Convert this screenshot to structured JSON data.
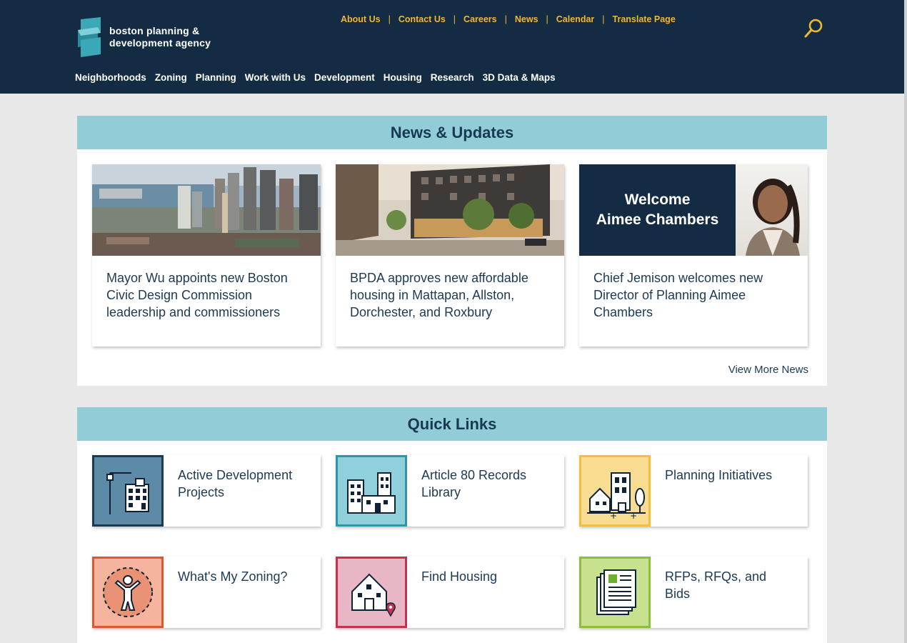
{
  "header": {
    "logo_line1": "boston planning &",
    "logo_line2": "development agency",
    "utility": [
      "About Us",
      "Contact Us",
      "Careers",
      "News",
      "Calendar",
      "Translate Page"
    ],
    "nav": [
      "Neighborhoods",
      "Zoning",
      "Planning",
      "Work with Us",
      "Development",
      "Housing",
      "Research",
      "3D Data & Maps"
    ]
  },
  "news": {
    "heading": "News & Updates",
    "cards": [
      {
        "title": "Mayor Wu appoints new Boston Civic Design Commission leadership and commissioners"
      },
      {
        "title": "BPDA approves new affordable housing in Mattapan, Allston, Dorchester, and Roxbury"
      },
      {
        "title": "Chief Jemison welcomes new Director of Planning Aimee Chambers",
        "banner_line1": "Welcome",
        "banner_line2": "Aimee Chambers"
      }
    ],
    "view_more": "View More News"
  },
  "quick_links": {
    "heading": "Quick Links",
    "items": [
      {
        "label": "Active Development Projects",
        "tile_bg": "#5d8aa6",
        "tile_border": "#1b3a52",
        "icon": "city-buildings-icon"
      },
      {
        "label": "Article 80 Records Library",
        "tile_bg": "#8fd0da",
        "tile_border": "#2a97ad",
        "icon": "buildings-library-icon"
      },
      {
        "label": "Planning Initiatives",
        "tile_bg": "#f7dc92",
        "tile_border": "#f0bf3b",
        "icon": "neighborhood-plan-icon"
      },
      {
        "label": "What's My Zoning?",
        "tile_bg": "#f6b39d",
        "tile_border": "#d95a2e",
        "icon": "person-zone-icon"
      },
      {
        "label": "Find Housing",
        "tile_bg": "#e8b6c4",
        "tile_border": "#c4334e",
        "icon": "house-location-icon"
      },
      {
        "label": "RFPs, RFQs, and Bids",
        "tile_bg": "#c7e18e",
        "tile_border": "#8cbd3f",
        "icon": "documents-icon"
      }
    ]
  },
  "colors": {
    "navy": "#132c44",
    "gold": "#f4b62c",
    "teal_band": "#92ccd6"
  }
}
